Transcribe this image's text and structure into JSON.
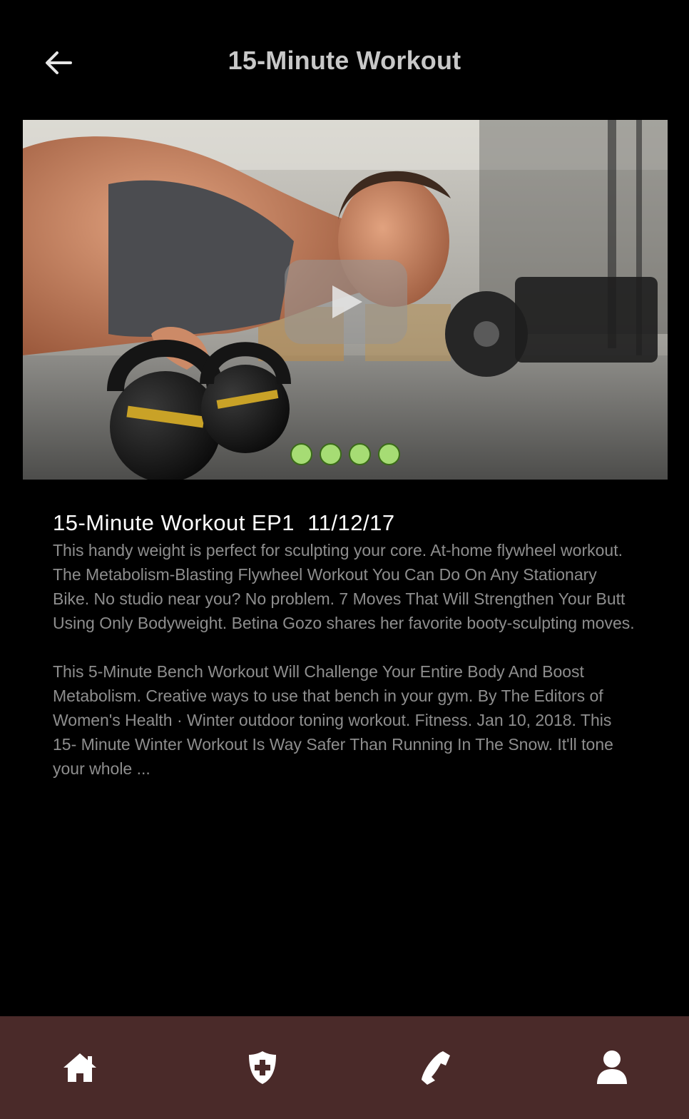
{
  "header": {
    "title": "15-Minute Workout",
    "back_icon": "arrow-left-icon"
  },
  "media": {
    "play_icon": "play-icon",
    "slide_count": 4
  },
  "article": {
    "title": "15-Minute Workout EP1  11/12/17",
    "paragraphs": [
      "This handy weight is perfect for sculpting your core. At-home flywheel workout. The Metabolism-Blasting Flywheel Workout You Can Do On Any Stationary Bike. No studio near you? No problem. 7 Moves That Will Strengthen Your Butt Using Only Bodyweight. Betina Gozo shares her favorite booty-sculpting moves.",
      "This 5-Minute Bench Workout Will Challenge Your Entire Body And Boost Metabolism. Creative ways to use that bench in your gym. By The Editors of Women's Health · Winter outdoor toning workout. Fitness. Jan 10, 2018. This 15- Minute Winter Workout Is Way Safer Than Running In The Snow. It'll tone your whole ..."
    ]
  },
  "tabbar": {
    "tabs": [
      "home-icon",
      "medical-shield-icon",
      "phone-icon",
      "user-icon"
    ]
  },
  "colors": {
    "background": "#000000",
    "tabbar": "#4a2a29",
    "dot": "#a6dc74",
    "title": "#c8c8c8",
    "body_text": "#8e8e8e"
  }
}
